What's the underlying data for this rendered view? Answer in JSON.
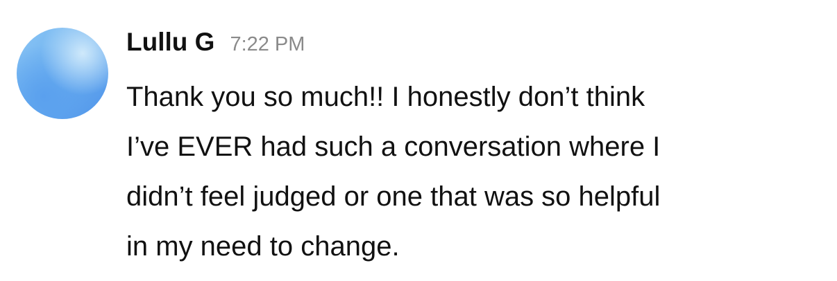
{
  "message": {
    "sender": "Lullu G",
    "timestamp": "7:22 PM",
    "avatar_icon": "user-avatar-icon",
    "text_lines": [
      "Thank you so much!! I honestly don’t think",
      "I’ve EVER had such a conversation where I",
      "didn’t feel judged or one that was so helpful",
      "in my need to change."
    ]
  },
  "colors": {
    "avatar_gradient_start": "#8cc6f5",
    "avatar_gradient_end": "#4f93ea",
    "sender": "#111111",
    "timestamp": "#8a8a8a",
    "text": "#111111",
    "background": "#ffffff"
  }
}
